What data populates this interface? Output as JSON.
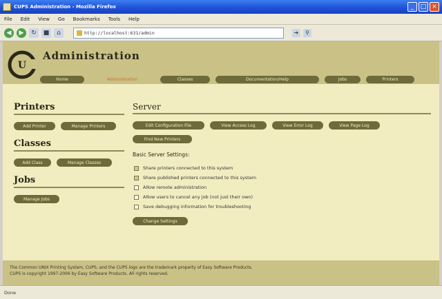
{
  "window": {
    "title": "CUPS Administration - Mozilla Firefox"
  },
  "menu": [
    "File",
    "Edit",
    "View",
    "Go",
    "Bookmarks",
    "Tools",
    "Help"
  ],
  "address": {
    "url": "http://localhost:631/admin"
  },
  "header": {
    "title": "Administration",
    "tabs": [
      {
        "label": "Home",
        "active": false
      },
      {
        "label": "Administration",
        "active": true
      },
      {
        "label": "Classes",
        "active": false
      },
      {
        "label": "Documentation/Help",
        "active": false
      },
      {
        "label": "Jobs",
        "active": false
      },
      {
        "label": "Printers",
        "active": false
      }
    ]
  },
  "left": {
    "printers": {
      "heading": "Printers",
      "buttons": [
        "Add Printer",
        "Manage Printers"
      ]
    },
    "classes": {
      "heading": "Classes",
      "buttons": [
        "Add Class",
        "Manage Classes"
      ]
    },
    "jobs": {
      "heading": "Jobs",
      "buttons": [
        "Manage Jobs"
      ]
    }
  },
  "server": {
    "heading": "Server",
    "buttons": [
      "Edit Configuration File",
      "View Access Log",
      "View Error Log",
      "View Page Log",
      "Find New Printers"
    ],
    "settings_heading": "Basic Server Settings:",
    "settings": [
      {
        "label": "Share printers connected to this system",
        "checked": true
      },
      {
        "label": "Share published printers connected to this system",
        "checked": true
      },
      {
        "label": "Allow remote administration",
        "checked": false
      },
      {
        "label": "Allow users to cancel any job (not just their own)",
        "checked": false
      },
      {
        "label": "Save debugging information for troubleshooting",
        "checked": false
      }
    ],
    "submit": "Change Settings"
  },
  "footer": {
    "line1": "The Common UNIX Printing System, CUPS, and the CUPS logo are the trademark property of Easy Software Products.",
    "line2": "CUPS is copyright 1997-2006 by Easy Software Products. All rights reserved."
  },
  "status": {
    "text": "Done"
  },
  "colors": {
    "page_bg": "#f2edc0",
    "header_bg": "#c9c186",
    "pill": "#6f6a3a",
    "active_tab": "#c7772c"
  }
}
